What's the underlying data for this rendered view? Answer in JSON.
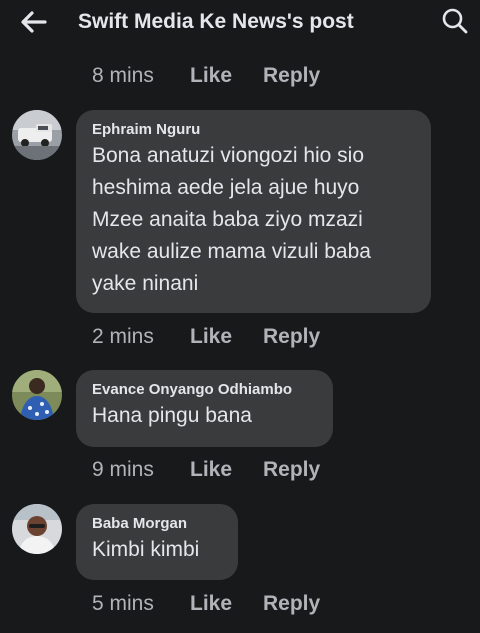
{
  "header": {
    "title": "Swift Media Ke News's post",
    "back_icon": "back-arrow-icon",
    "search_icon": "search-icon"
  },
  "top_actions": {
    "time": "8 mins",
    "like": "Like",
    "reply": "Reply"
  },
  "comments": [
    {
      "author": "Ephraim Nguru",
      "text": "Bona anatuzi viongozi hio sio heshima aede jela ajue huyo Mzee anaita baba ziyo mzazi wake aulize mama vizuli baba yake ninani",
      "time": "2 mins",
      "like": "Like",
      "reply": "Reply"
    },
    {
      "author": "Evance Onyango Odhiambo",
      "text": "Hana pingu bana",
      "time": "9 mins",
      "like": "Like",
      "reply": "Reply"
    },
    {
      "author": "Baba Morgan",
      "text": "Kimbi kimbi",
      "time": "5 mins",
      "like": "Like",
      "reply": "Reply"
    }
  ],
  "colors": {
    "background": "#18191a",
    "bubble": "#3a3b3c",
    "primary_text": "#e4e6eb",
    "secondary_text": "#b0b3b8"
  }
}
